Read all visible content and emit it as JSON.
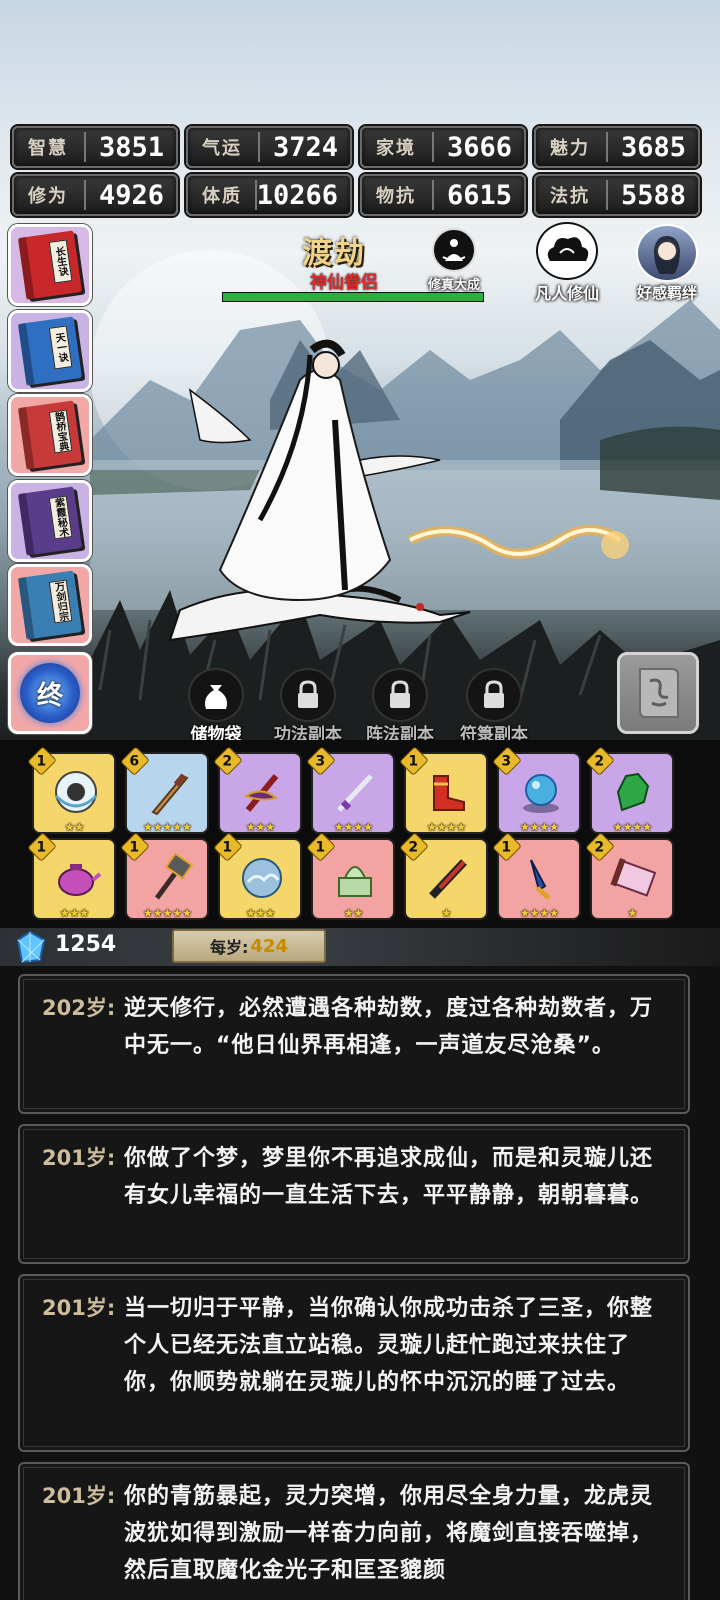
{
  "stats_row1": [
    {
      "label": "智慧",
      "value": "3851"
    },
    {
      "label": "气运",
      "value": "3724"
    },
    {
      "label": "家境",
      "value": "3666"
    },
    {
      "label": "魅力",
      "value": "3685"
    }
  ],
  "stats_row2": [
    {
      "label": "修为",
      "value": "4926"
    },
    {
      "label": "体质",
      "value": "10266"
    },
    {
      "label": "物抗",
      "value": "6615"
    },
    {
      "label": "法抗",
      "value": "5588"
    }
  ],
  "books": [
    {
      "title": "长生诀",
      "color": "#c8282a"
    },
    {
      "title": "天一诀",
      "color": "#2e6fc2"
    },
    {
      "title": "鹊桥宝典",
      "color": "#c83a3a"
    },
    {
      "title": "紫霞秘术",
      "color": "#5a3d8a"
    },
    {
      "title": "万剑归宗",
      "color": "#3a7fb4"
    }
  ],
  "realm": {
    "name": "渡劫",
    "sub": "神仙眷侣",
    "progress": 1.0
  },
  "badges": {
    "xiuzhen": "修真大成",
    "fanren": "凡人修仙",
    "haogan": "好感羁绊"
  },
  "final_button": {
    "glyph": "终"
  },
  "tabs": [
    {
      "label": "储物袋",
      "locked": false
    },
    {
      "label": "功法副本",
      "locked": true
    },
    {
      "label": "阵法副本",
      "locked": true
    },
    {
      "label": "符箓副本",
      "locked": true
    }
  ],
  "inventory_row1": [
    {
      "qty": "1",
      "stars": "★★",
      "bg": "#f5d66b",
      "icon": "lotus-orb-icon"
    },
    {
      "qty": "6",
      "stars": "★★★★★",
      "bg": "#b7d6ee",
      "icon": "wooden-sword-icon"
    },
    {
      "qty": "2",
      "stars": "★★★",
      "bg": "#c9a6e8",
      "icon": "demon-sword-icon"
    },
    {
      "qty": "3",
      "stars": "★★★★",
      "bg": "#c9a6e8",
      "icon": "purple-sword-icon"
    },
    {
      "qty": "1",
      "stars": "★★★★",
      "bg": "#f5d66b",
      "icon": "red-boots-icon"
    },
    {
      "qty": "3",
      "stars": "★★★★",
      "bg": "#c9a6e8",
      "icon": "blue-pearl-icon"
    },
    {
      "qty": "2",
      "stars": "★★★★",
      "bg": "#c9a6e8",
      "icon": "green-glove-icon"
    }
  ],
  "inventory_row2": [
    {
      "qty": "1",
      "stars": "★★★",
      "bg": "#f5d66b",
      "icon": "teapot-icon"
    },
    {
      "qty": "1",
      "stars": "★★★★★",
      "bg": "#f4a3a3",
      "icon": "war-hammer-icon"
    },
    {
      "qty": "1",
      "stars": "★★★",
      "bg": "#f5d66b",
      "icon": "cloud-orb-icon"
    },
    {
      "qty": "1",
      "stars": "★★",
      "bg": "#f4a3a3",
      "icon": "jade-seal-icon"
    },
    {
      "qty": "2",
      "stars": "★",
      "bg": "#f5d66b",
      "icon": "red-blade-icon"
    },
    {
      "qty": "1",
      "stars": "★★★★",
      "bg": "#f4a3a3",
      "icon": "blue-dagger-icon"
    },
    {
      "qty": "2",
      "stars": "★",
      "bg": "#f4a3a3",
      "icon": "pink-scroll-icon"
    }
  ],
  "currency": {
    "value": "1254",
    "per_year_label": "每岁:",
    "per_year_value": "424"
  },
  "log": [
    {
      "age": "202岁:",
      "text": "逆天修行，必然遭遇各种劫数，度过各种劫数者，万中无一。“他日仙界再相逢，一声道友尽沧桑”。"
    },
    {
      "age": "201岁:",
      "text": "你做了个梦，梦里你不再追求成仙，而是和灵璇儿还有女儿幸福的一直生活下去，平平静静，朝朝暮暮。"
    },
    {
      "age": "201岁:",
      "text": "当一切归于平静，当你确认你成功击杀了三圣，你整个人已经无法直立站稳。灵璇儿赶忙跑过来扶住了你，你顺势就躺在灵璇儿的怀中沉沉的睡了过去。"
    },
    {
      "age": "201岁:",
      "text": "你的青筋暴起，灵力突增，你用尽全身力量，龙虎灵波犹如得到激励一样奋力向前，将魔剑直接吞噬掉，然后直取魔化金光子和匡圣貔颜"
    }
  ]
}
